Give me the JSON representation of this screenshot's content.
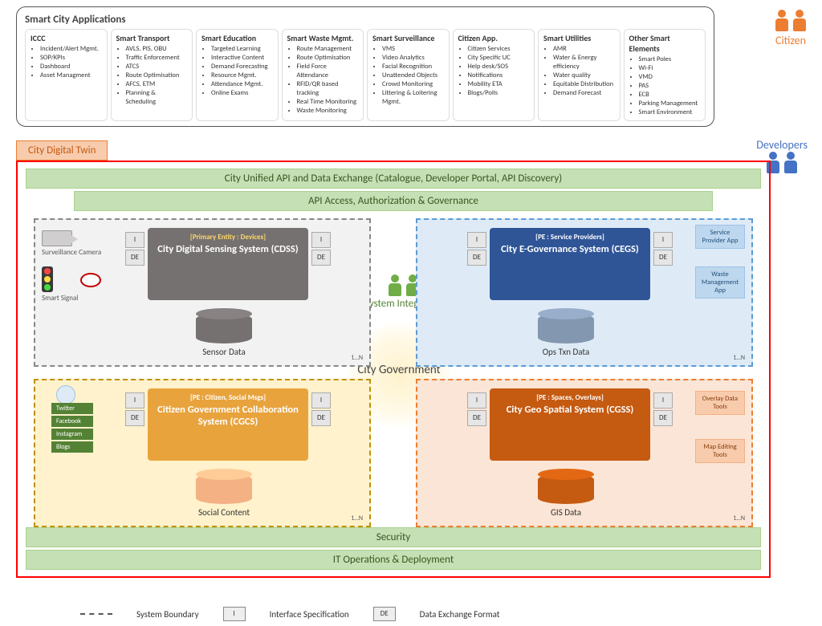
{
  "apps": {
    "title": "Smart City Applications",
    "cols": [
      {
        "h": "ICCC",
        "items": [
          "Incident/Alert Mgmt.",
          "SOP/KPIs",
          "Dashboard",
          "Asset Managment"
        ]
      },
      {
        "h": "Smart Transport",
        "items": [
          "AVLS, PIS, OBU",
          "Traffic Enforcement",
          "ATCS",
          "Route Optimisation",
          "AFCS, ETM",
          "Planning & Scheduling"
        ]
      },
      {
        "h": "Smart Education",
        "items": [
          "Targeted Learning",
          "Interactive Content",
          "Demand Forecasting",
          "Resource Mgmt.",
          "Attendance Mgmt.",
          "Online Exams"
        ]
      },
      {
        "h": "Smart Waste Mgmt.",
        "items": [
          "Route Management",
          "Route Optimisation",
          "Field Force Attendance",
          "RFID/QR based tracking",
          "Real Time Monitoring",
          "Waste Monitoring"
        ]
      },
      {
        "h": "Smart Surveillance",
        "items": [
          "VMS",
          "Video Analytics",
          "Facial Recognition",
          "Unattended Objects",
          "Crowd Monitoring",
          "Littering & Loitering Mgmt."
        ]
      },
      {
        "h": "Citizen App.",
        "items": [
          "Citizen Services",
          "City Specific UC",
          "Help desk/SOS",
          "Notifications",
          "Mobility ETA",
          "Blogs/Polls"
        ]
      },
      {
        "h": "Smart Utilities",
        "items": [
          "AMR",
          "Water & Energy efficiency",
          "Water quality",
          "Equitable Distribution",
          "Demand Forecast"
        ]
      },
      {
        "h": "Other Smart Elements",
        "items": [
          "Smart Poles",
          "Wi-Fi",
          "VMD",
          "PAS",
          "ECB",
          "Parking Management",
          "Smart Environment"
        ]
      }
    ]
  },
  "labels": {
    "citizen": "Citizen",
    "developers": "Developers",
    "twin": "City Digital Twin",
    "bar1": "City Unified API and Data Exchange (Catalogue, Developer Portal, API Discovery)",
    "bar2": "API Access, Authorization & Governance",
    "security": "Security",
    "itops": "IT Operations & Deployment",
    "si": "System Integrators",
    "center": "City Government",
    "cam": "Surveillance Camera",
    "sig": "Smart Signal",
    "mult": "1…N",
    "i": "I",
    "de": "DE"
  },
  "systems": {
    "cdss": {
      "pe": "[Primary Entity : Devices]",
      "name": "City Digital Sensing System (CDSS)",
      "db": "Sensor Data"
    },
    "cegs": {
      "pe": "[PE : Service Providers]",
      "name": "City E-Governance System (CEGS)",
      "db": "Ops Txn Data"
    },
    "cgcs": {
      "pe": "[PE : Citizen, Social Msgs]",
      "name": "Citizen Government Collaboration System (CGCS)",
      "db": "Social Content"
    },
    "cgss": {
      "pe": "[PE : Spaces, Overlays]",
      "name": "City Geo Spatial System (CGSS)",
      "db": "GIS Data"
    }
  },
  "social": [
    "Twitter",
    "Facebook",
    "Instagram",
    "Blogs"
  ],
  "svc": {
    "a": "Service Provider App",
    "b": "Waste Management App"
  },
  "tools": {
    "a": "Overlay Data Tools",
    "b": "Map Editing Tools"
  },
  "legend": {
    "a": "System Boundary",
    "b": "Interface Specification",
    "c": "Data Exchange Format"
  }
}
